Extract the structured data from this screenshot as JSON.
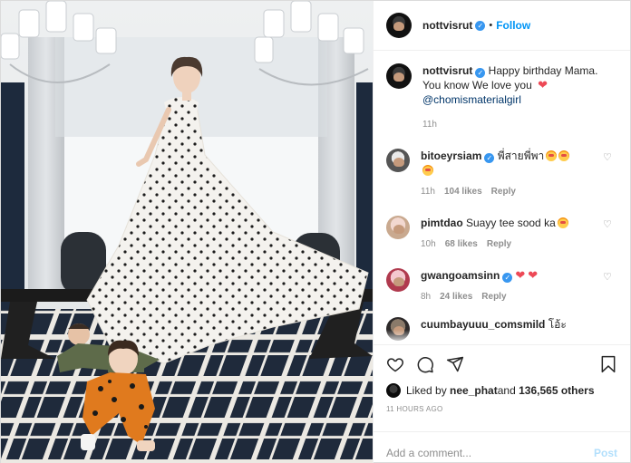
{
  "post": {
    "username": "nottvisrut",
    "follow_label": "Follow",
    "separator": "•",
    "caption": {
      "username": "nottvisrut",
      "text": " Happy birthday Mama. You know We love you ",
      "mention": "@chomismaterialgirl",
      "time": "11h"
    },
    "comments": [
      {
        "username": "bitoeyrsiam",
        "text": " พี่สายพี่พา",
        "time": "11h",
        "likes": "104 likes",
        "reply": "Reply",
        "verified": true
      },
      {
        "username": "pimtdao",
        "text": " Suayy tee sood ka",
        "time": "10h",
        "likes": "68 likes",
        "reply": "Reply",
        "verified": false
      },
      {
        "username": "gwangoamsinn",
        "text": "",
        "time": "8h",
        "likes": "24 likes",
        "reply": "Reply",
        "verified": true
      },
      {
        "username": "cuumbayuuu_comsmild",
        "text": " โอ้ะ",
        "time": "",
        "likes": "",
        "reply": "",
        "verified": false
      }
    ],
    "liked_by_prefix": "Liked by ",
    "liked_by_user": "nee_phat",
    "liked_by_suffix": " and ",
    "liked_count": "136,565 others",
    "posted_ago": "11 HOURS AGO",
    "add_comment_placeholder": "Add a comment...",
    "post_label": "Post"
  },
  "colors": {
    "accent": "#0095f6",
    "verified": "#3897f0",
    "heart": "#ed4956",
    "post_disabled": "#b2dffc"
  },
  "icons": [
    "heart-icon",
    "comment-icon",
    "share-icon",
    "bookmark-icon",
    "verified-badge-icon"
  ]
}
